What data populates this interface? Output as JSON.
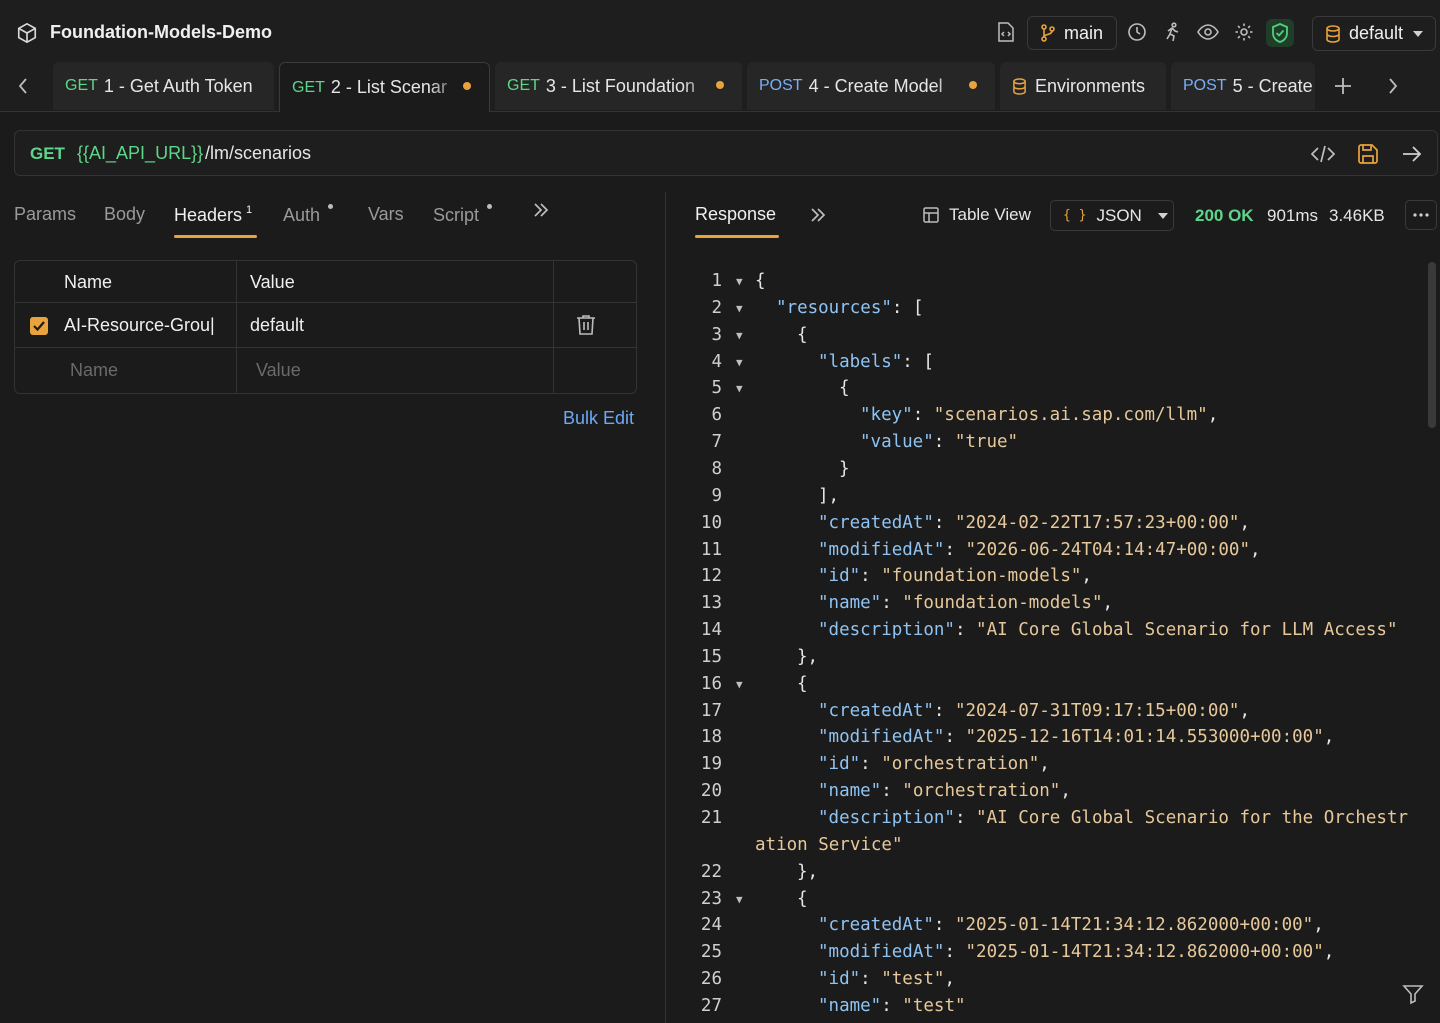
{
  "app": {
    "title": "Foundation-Models-Demo"
  },
  "topbar": {
    "branch": "main",
    "environment": "default"
  },
  "tabs": [
    {
      "method": "GET",
      "label": "1 - Get Auth Token",
      "active": false,
      "modified": false
    },
    {
      "method": "GET",
      "label": "2 - List Scenar",
      "active": true,
      "modified": true
    },
    {
      "method": "GET",
      "label": "3 - List Foundation",
      "active": false,
      "modified": true
    },
    {
      "method": "POST",
      "label": "4 - Create Model",
      "active": false,
      "modified": true
    },
    {
      "method": "",
      "label": "Environments",
      "active": false,
      "modified": false
    },
    {
      "method": "POST",
      "label": "5 - Create",
      "active": false,
      "modified": false
    }
  ],
  "request": {
    "method": "GET",
    "url_var": "{{AI_API_URL}}",
    "url_path": "/lm/scenarios"
  },
  "request_tabs": [
    {
      "label": "Params"
    },
    {
      "label": "Body"
    },
    {
      "label": "Headers",
      "badge": "1"
    },
    {
      "label": "Auth"
    },
    {
      "label": "Vars"
    },
    {
      "label": "Script"
    }
  ],
  "headers_table": {
    "columns": [
      "Name",
      "Value"
    ],
    "rows": [
      {
        "name": "AI-Resource-Grou|",
        "value": "default",
        "enabled": true
      }
    ],
    "placeholder_name": "Name",
    "placeholder_value": "Value",
    "bulk_edit": "Bulk Edit"
  },
  "response": {
    "tab": "Response",
    "table_view": "Table View",
    "format": "JSON",
    "status": "200 OK",
    "time": "901ms",
    "size": "3.46KB"
  },
  "code_lines": [
    {
      "n": "1",
      "fold": true,
      "indent": 0,
      "text": "{"
    },
    {
      "n": "2",
      "fold": true,
      "indent": 1,
      "key": "resources",
      "text": "["
    },
    {
      "n": "3",
      "fold": true,
      "indent": 2,
      "text": "{"
    },
    {
      "n": "4",
      "fold": true,
      "indent": 3,
      "key": "labels",
      "text": "["
    },
    {
      "n": "5",
      "fold": true,
      "indent": 4,
      "text": "{"
    },
    {
      "n": "6",
      "fold": false,
      "indent": 5,
      "key": "key",
      "str": "scenarios.ai.sap.com/llm",
      "tail": ","
    },
    {
      "n": "7",
      "fold": false,
      "indent": 5,
      "key": "value",
      "str": "true",
      "tail": ""
    },
    {
      "n": "8",
      "fold": false,
      "indent": 4,
      "text": "}"
    },
    {
      "n": "9",
      "fold": false,
      "indent": 3,
      "text": "],"
    },
    {
      "n": "10",
      "fold": false,
      "indent": 3,
      "key": "createdAt",
      "str": "2024-02-22T17:57:23+00:00",
      "tail": ","
    },
    {
      "n": "11",
      "fold": false,
      "indent": 3,
      "key": "modifiedAt",
      "str": "2026-06-24T04:14:47+00:00",
      "tail": ","
    },
    {
      "n": "12",
      "fold": false,
      "indent": 3,
      "key": "id",
      "str": "foundation-models",
      "tail": ","
    },
    {
      "n": "13",
      "fold": false,
      "indent": 3,
      "key": "name",
      "str": "foundation-models",
      "tail": ","
    },
    {
      "n": "14",
      "fold": false,
      "indent": 3,
      "key": "description",
      "str": "AI Core Global Scenario for LLM Access",
      "tail": ""
    },
    {
      "n": "15",
      "fold": false,
      "indent": 2,
      "text": "},"
    },
    {
      "n": "16",
      "fold": true,
      "indent": 2,
      "text": "{"
    },
    {
      "n": "17",
      "fold": false,
      "indent": 3,
      "key": "createdAt",
      "str": "2024-07-31T09:17:15+00:00",
      "tail": ","
    },
    {
      "n": "18",
      "fold": false,
      "indent": 3,
      "key": "modifiedAt",
      "str": "2025-12-16T14:01:14.553000+00:00",
      "tail": ","
    },
    {
      "n": "19",
      "fold": false,
      "indent": 3,
      "key": "id",
      "str": "orchestration",
      "tail": ","
    },
    {
      "n": "20",
      "fold": false,
      "indent": 3,
      "key": "name",
      "str": "orchestration",
      "tail": ","
    },
    {
      "n": "21",
      "fold": false,
      "indent": 3,
      "key": "description",
      "str": "AI Core Global Scenario for the Orchestr",
      "tail": "",
      "wrap": "ation Service\""
    },
    {
      "n": "22",
      "fold": false,
      "indent": 2,
      "text": "},"
    },
    {
      "n": "23",
      "fold": true,
      "indent": 2,
      "text": "{"
    },
    {
      "n": "24",
      "fold": false,
      "indent": 3,
      "key": "createdAt",
      "str": "2025-01-14T21:34:12.862000+00:00",
      "tail": ","
    },
    {
      "n": "25",
      "fold": false,
      "indent": 3,
      "key": "modifiedAt",
      "str": "2025-01-14T21:34:12.862000+00:00",
      "tail": ","
    },
    {
      "n": "26",
      "fold": false,
      "indent": 3,
      "key": "id",
      "str": "test",
      "tail": ","
    },
    {
      "n": "27",
      "fold": false,
      "indent": 3,
      "key": "name",
      "str": "test",
      "tail": ""
    }
  ]
}
